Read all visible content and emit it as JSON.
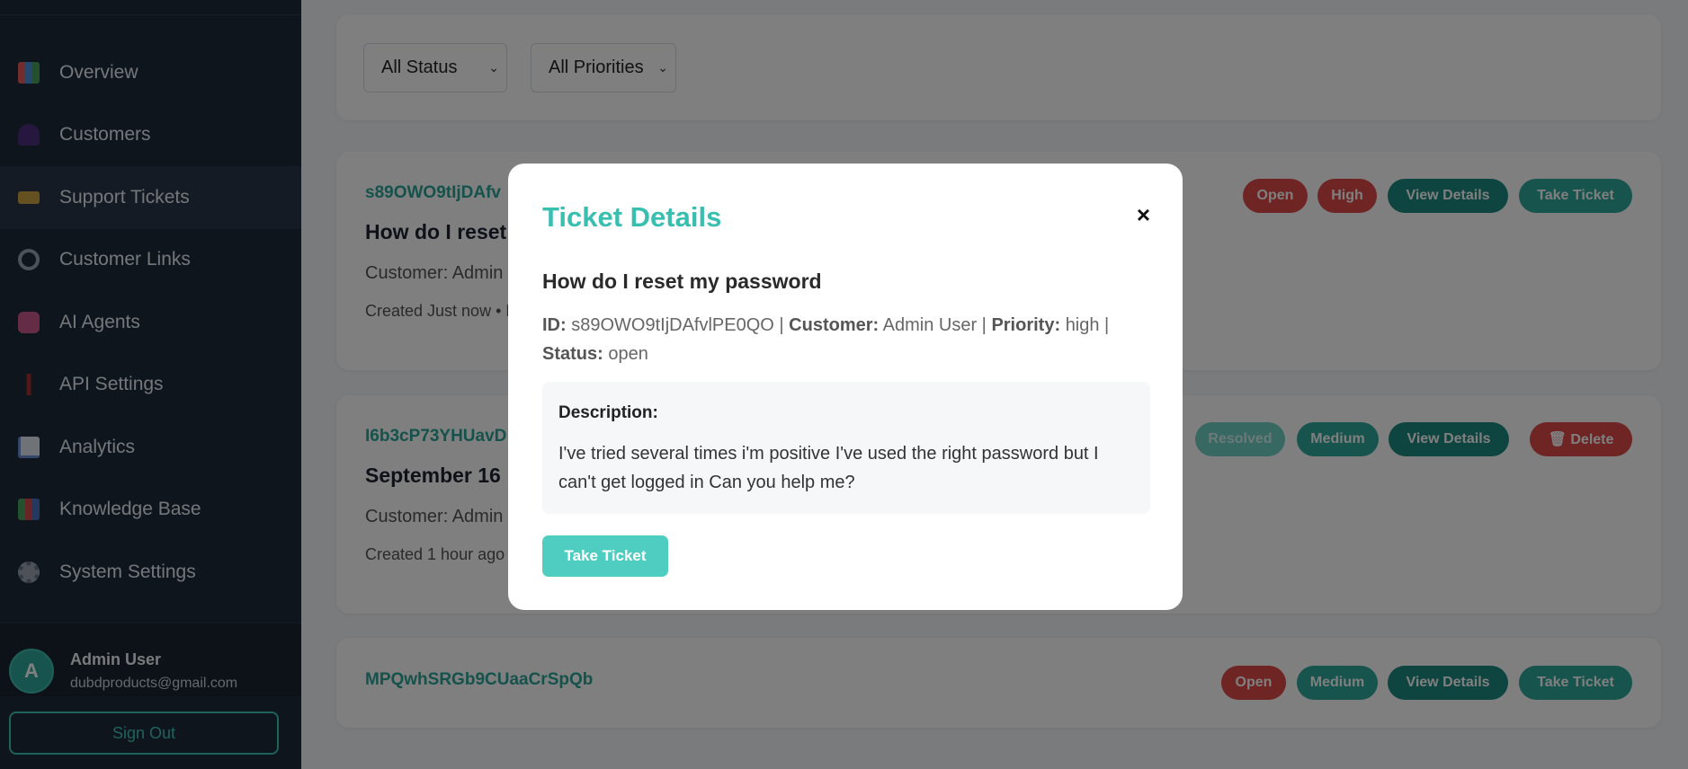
{
  "sidebar": {
    "items": [
      {
        "label": "Overview",
        "icon": "chart-icon",
        "color": "#e85a5a"
      },
      {
        "label": "Customers",
        "icon": "people-icon",
        "color": "#7c4dbd"
      },
      {
        "label": "Support Tickets",
        "icon": "ticket-icon",
        "color": "#e6b84a"
      },
      {
        "label": "Customer Links",
        "icon": "link-icon",
        "color": "#aab4c0"
      },
      {
        "label": "AI Agents",
        "icon": "robot-icon",
        "color": "#c85a8a"
      },
      {
        "label": "API Settings",
        "icon": "plug-icon",
        "color": "#c03a3a"
      },
      {
        "label": "Analytics",
        "icon": "trend-icon",
        "color": "#6a8fd0"
      },
      {
        "label": "Knowledge Base",
        "icon": "books-icon",
        "color": "#4aa060"
      },
      {
        "label": "System Settings",
        "icon": "gear-icon",
        "color": "#9aa5b2"
      }
    ],
    "active_index": 2,
    "user": {
      "initial": "A",
      "name": "Admin User",
      "email": "dubdproducts@gmail.com"
    },
    "signout_label": "Sign Out"
  },
  "filters": {
    "status": "All Status",
    "priority": "All Priorities"
  },
  "tickets": [
    {
      "id": "s89OWO9tIjDAfv",
      "title": "How do I reset",
      "customer": "Customer: Admin",
      "created": "Created Just now • M",
      "status": "Open",
      "priority": "High",
      "view": "View Details",
      "action": "Take Ticket"
    },
    {
      "id": "I6b3cP73YHUavD",
      "title": "September 16",
      "customer": "Customer: Admin",
      "created": "Created 1 hour ago",
      "status": "Resolved",
      "priority": "Medium",
      "view": "View Details",
      "action": "🗑 Delete"
    },
    {
      "id": "MPQwhSRGb9CUaaCrSpQb",
      "status": "Open",
      "priority": "Medium",
      "view": "View Details",
      "action": "Take Ticket"
    }
  ],
  "modal": {
    "title": "Ticket Details",
    "close": "×",
    "subject": "How do I reset my password",
    "id_label": "ID:",
    "id_value": "s89OWO9tIjDAfvlPE0QO",
    "customer_label": "Customer:",
    "customer_value": "Admin User",
    "priority_label": "Priority:",
    "priority_value": "high",
    "status_label": "Status:",
    "status_value": "open",
    "description_label": "Description:",
    "description": "I've tried several times i'm positive I've used the right password but I can't get logged in Can you help me?",
    "action_label": "Take Ticket"
  }
}
